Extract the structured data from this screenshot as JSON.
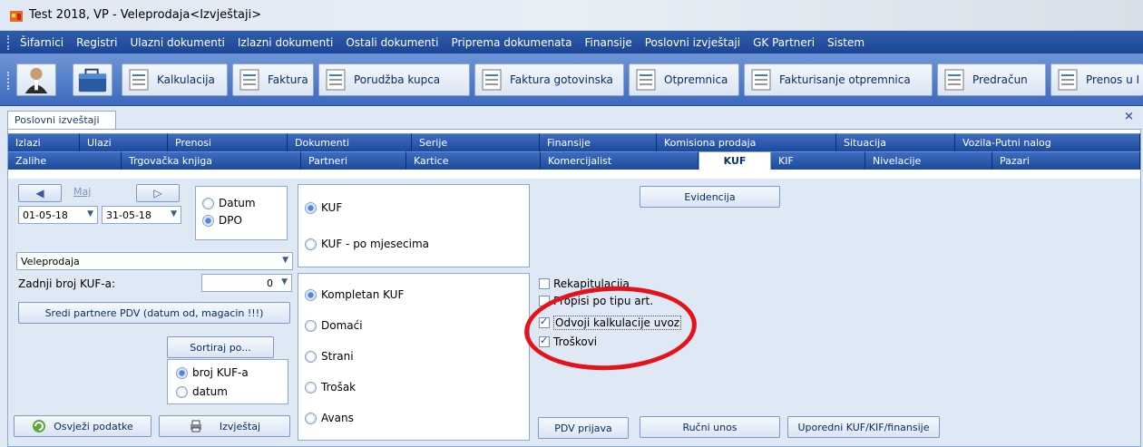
{
  "window": {
    "title": "Test 2018, VP - Veleprodaja<Izvještaji>"
  },
  "menu": [
    "Šifarnici",
    "Registri",
    "Ulazni dokumenti",
    "Izlazni dokumenti",
    "Ostali dokumenti",
    "Priprema dokumenata",
    "Finansije",
    "Poslovni izvještaji",
    "GK Partneri",
    "Sistem"
  ],
  "toolbar": {
    "buttons": [
      "Kalkulacija",
      "Faktura",
      "Porudžba kupca",
      "Faktura gotovinska",
      "Otpremnica",
      "Fakturisanje otpremnica",
      "Predračun",
      "Prenos u I"
    ]
  },
  "doc_tab": "Poslovni izveštaji",
  "tabs_row1": [
    "Izlazi",
    "Ulazi",
    "Prenosi",
    "Dokumenti",
    "Serije",
    "Finansije",
    "Komisiona prodaja",
    "Situacija",
    "Vozila-Putni nalog"
  ],
  "tabs_row2": [
    "Zalihe",
    "Trgovačka knjiga",
    "Partneri",
    "Kartice",
    "Komercijalist",
    "KUF",
    "KIF",
    "Nivelacije",
    "Pazari"
  ],
  "period": {
    "month": "Maj",
    "from": "01-05-18",
    "to": "31-05-18"
  },
  "date_mode": {
    "options": [
      "Datum",
      "DPO"
    ],
    "selected": "DPO"
  },
  "warehouse": "Veleprodaja",
  "last_kuf": {
    "label": "Zadnji broj KUF-a:",
    "value": "0"
  },
  "sredi_btn": "Sredi partnere PDV (datum od, magacin !!!)",
  "sort": {
    "label": "Sortiraj po...",
    "options": [
      "broj KUF-a",
      "datum"
    ],
    "selected": "broj KUF-a"
  },
  "refresh_btn": "Osvježi podatke",
  "report_btn": "Izvještaj",
  "kuf_mode": {
    "options": [
      "KUF",
      "KUF - po mjesecima"
    ],
    "selected": "KUF"
  },
  "kuf_type": {
    "options": [
      "Kompletan KUF",
      "Domaći",
      "Strani",
      "Trošak",
      "Avans"
    ],
    "selected": "Kompletan KUF"
  },
  "evidencija_btn": "Evidencija",
  "checks": [
    {
      "label": "Rekapitulacija",
      "checked": false
    },
    {
      "label": "Propisi po tipu art.",
      "checked": false
    },
    {
      "label": "Odvoji kalkulacije uvoz",
      "checked": true
    },
    {
      "label": "Troškovi",
      "checked": true
    }
  ],
  "pdv_btn": "PDV prijava",
  "manual_btn": "Ručni unos",
  "compare_btn": "Uporedni KUF/KIF/finansije",
  "colors": {
    "menubar": "#1c4596",
    "tab": "#2a58ac",
    "highlight": "#e3121b"
  }
}
